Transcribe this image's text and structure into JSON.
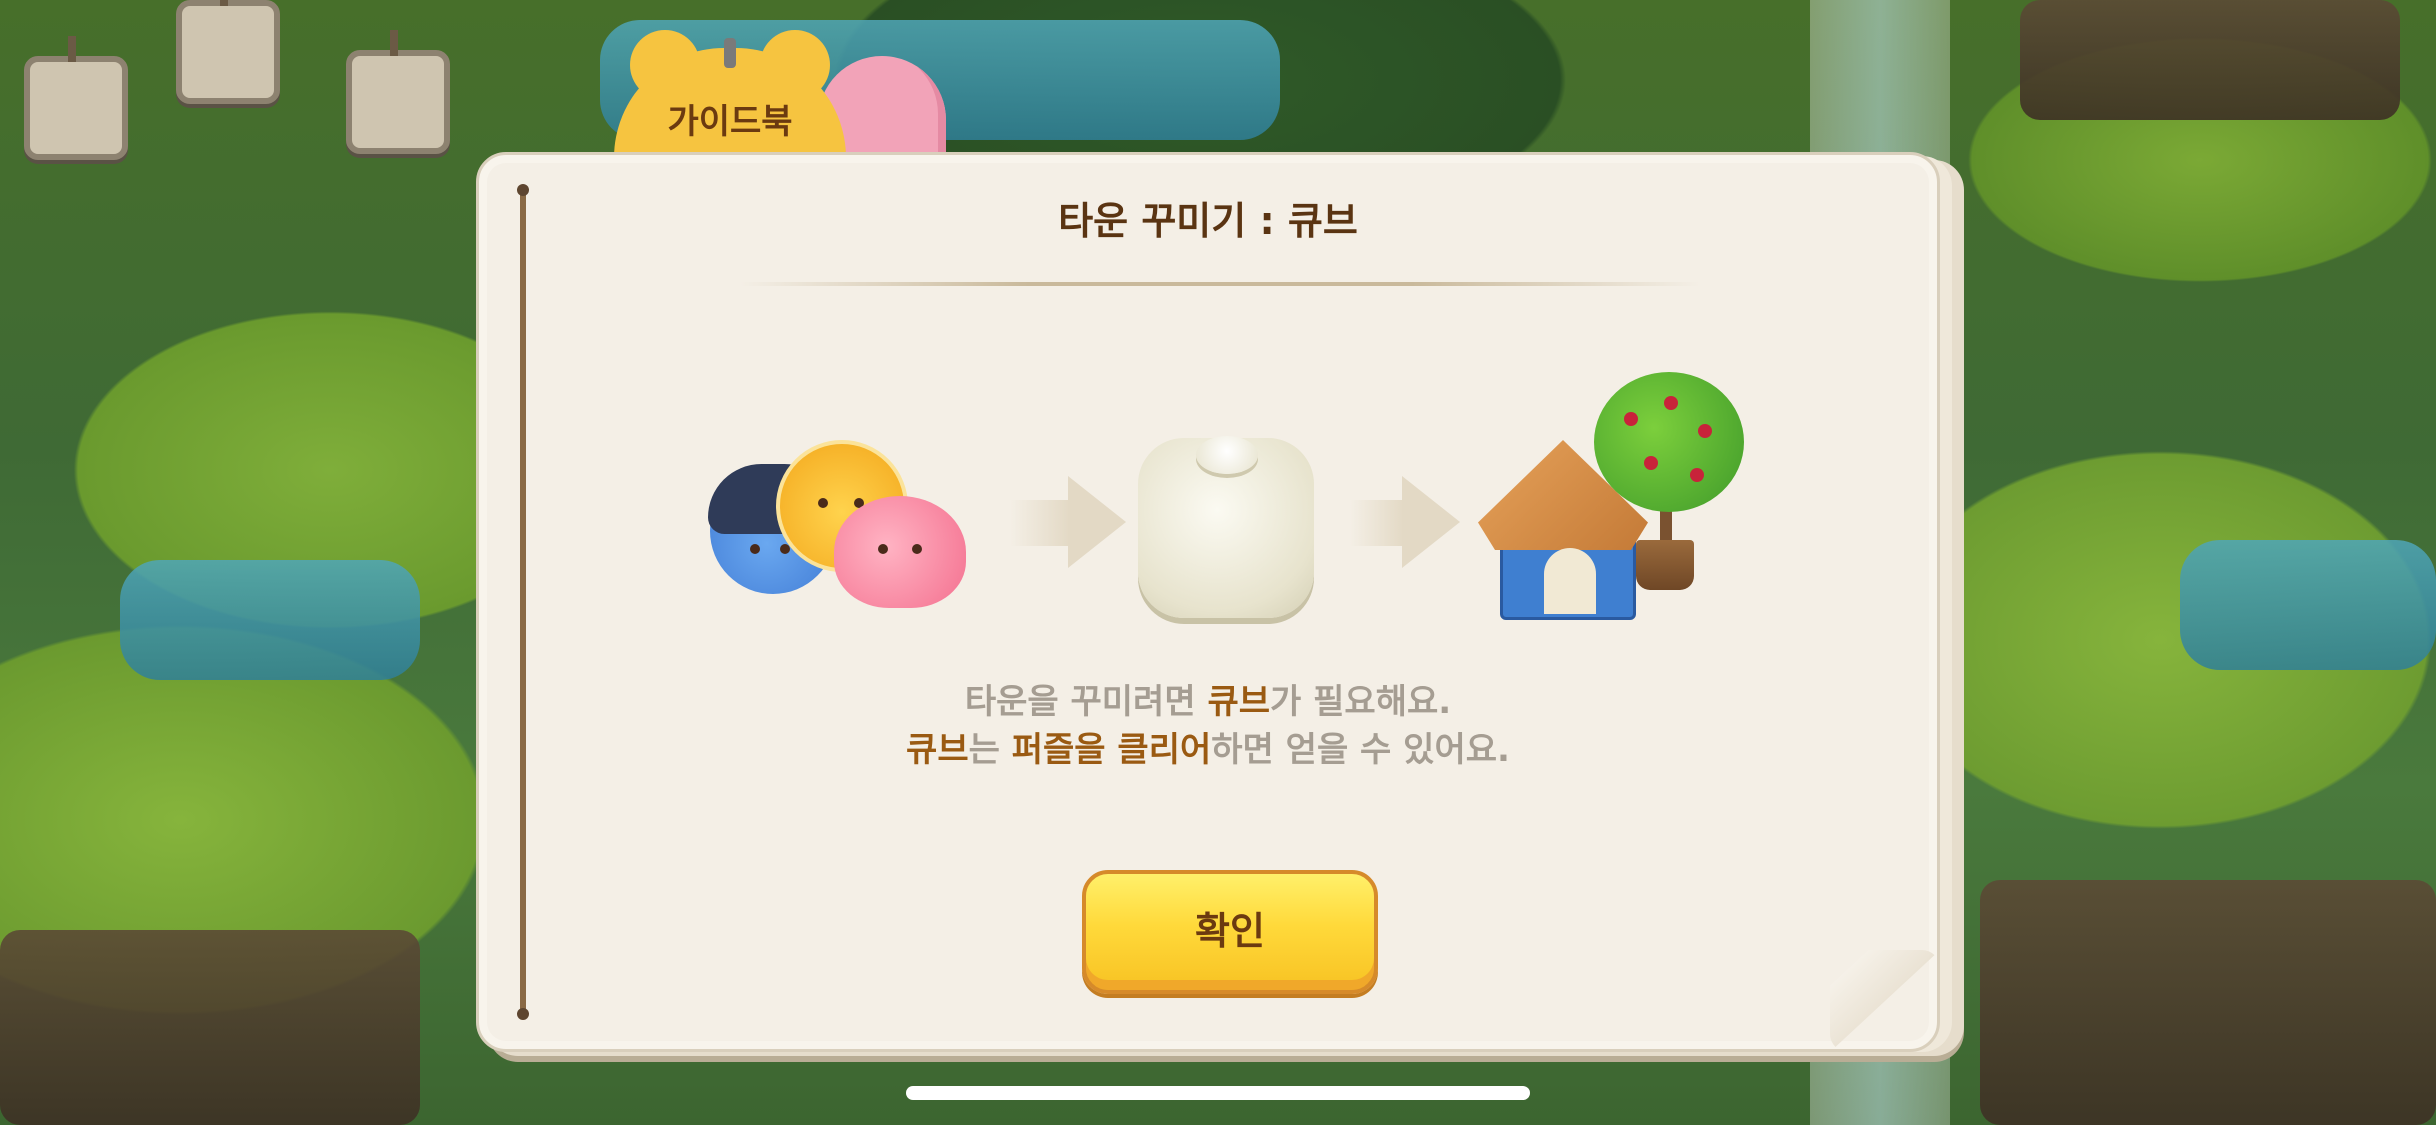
{
  "guide_tab": {
    "label": "가이드북"
  },
  "dialog": {
    "title": "타운 꾸미기 : 큐브",
    "line1": {
      "part1": "타운을 꾸미려면 ",
      "highlight1": "큐브",
      "part2": "가 필요해요."
    },
    "line2": {
      "highlight1": "큐브",
      "part1": "는 ",
      "highlight2": "퍼즐을 클리어",
      "part2": "하면 얻을 수 있어요."
    },
    "confirm_label": "확인"
  },
  "colors": {
    "title_text": "#5a3412",
    "highlight_text": "#9a5a12",
    "body_text": "#a59d92",
    "button_yellow": "#ffd93a"
  },
  "icons": [
    "friends-puzzle-pieces-icon",
    "arrow-right-icon",
    "cube-icon",
    "house-and-tree-icon"
  ]
}
